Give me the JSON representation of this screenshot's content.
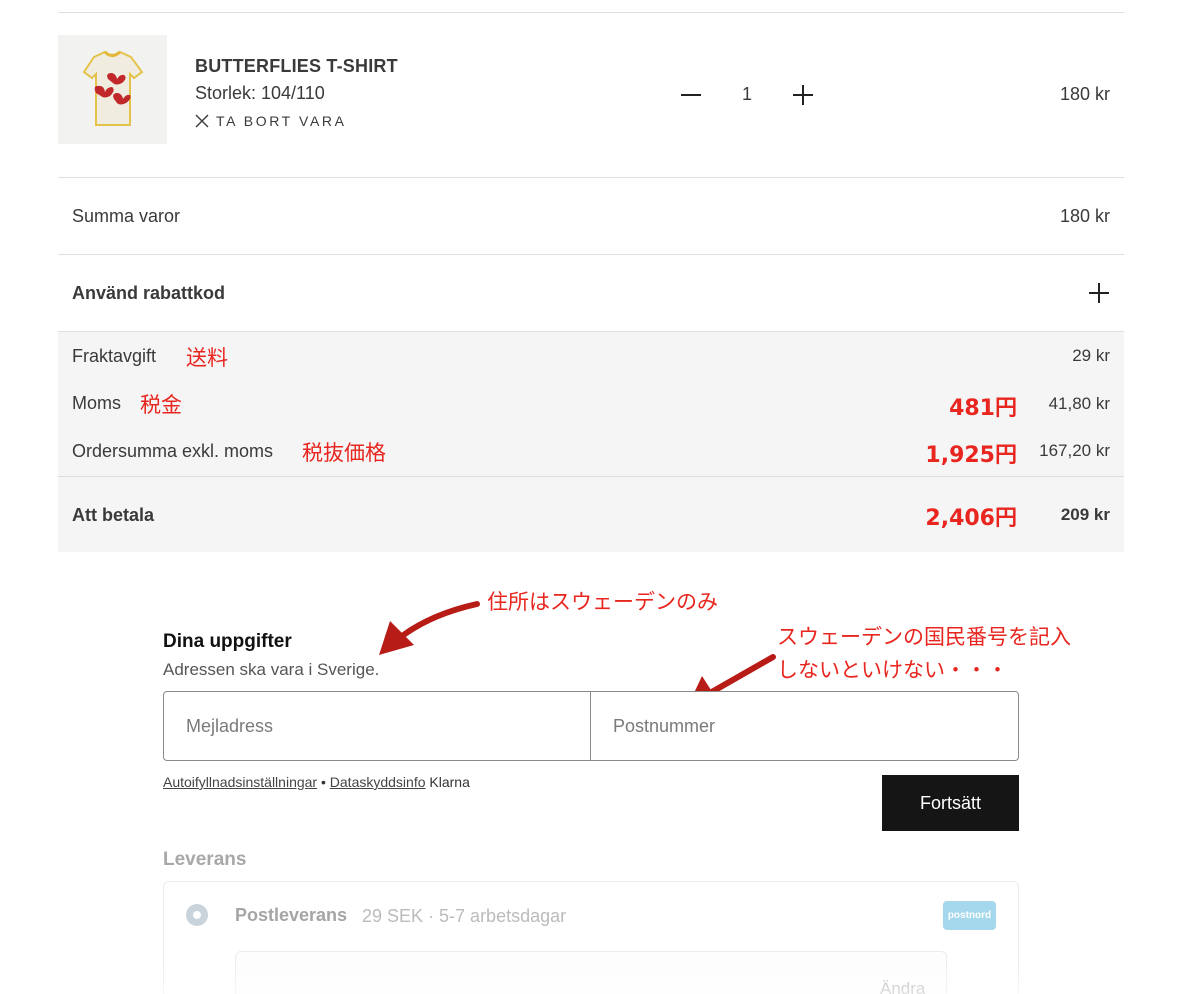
{
  "cart": {
    "item": {
      "name": "BUTTERFLIES T-SHIRT",
      "size": "Storlek: 104/110",
      "remove_label": "TA BORT VARA",
      "quantity": "1",
      "price": "180 kr"
    }
  },
  "summary": {
    "items_label": "Summa varor",
    "items_value": "180 kr",
    "discount_label": "Använd rabattkod",
    "shipping_label": "Fraktavgift",
    "shipping_value": "29 kr",
    "vat_label": "Moms",
    "vat_value": "41,80 kr",
    "excl_label": "Ordersumma exkl. moms",
    "excl_value": "167,20 kr",
    "total_label": "Att betala",
    "total_value": "209 kr"
  },
  "annotations": {
    "shipping_jp": "送料",
    "vat_jp": "税金",
    "excl_jp": "税抜価格",
    "vat_yen": "481円",
    "excl_yen": "1,925円",
    "total_yen": "2,406円",
    "address_note": "住所はスウェーデンのみ",
    "id_note_line1": "スウェーデンの国民番号を記入",
    "id_note_line2": "しないといけない・・・",
    "color": "#e8261f",
    "arrow_color": "#b81c17"
  },
  "details": {
    "title": "Dina uppgifter",
    "subtitle": "Adressen ska vara i Sverige.",
    "email_placeholder": "Mejladress",
    "postal_placeholder": "Postnummer",
    "link_autofill": "Autoifyllnadsinställningar",
    "separator": " • ",
    "link_privacy": "Dataskyddsinfo",
    "brand": "Klarna",
    "continue_label": "Fortsätt"
  },
  "delivery": {
    "title": "Leverans",
    "option_name": "Postleverans",
    "option_info": "29 SEK · 5-7 arbetsdagar",
    "carrier": "postnord",
    "change_label": "Ändra"
  }
}
